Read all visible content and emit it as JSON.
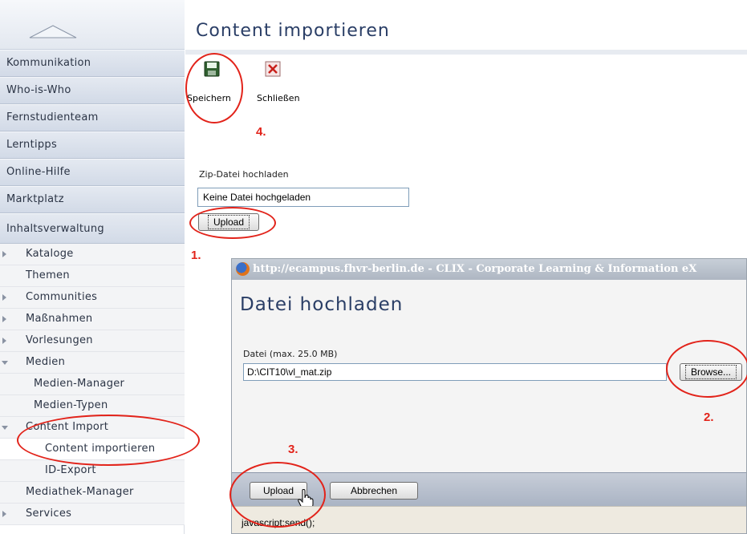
{
  "sidebar": {
    "main_items": [
      {
        "label": "Kommunikation"
      },
      {
        "label": "Who-is-Who"
      },
      {
        "label": "Fernstudienteam"
      },
      {
        "label": "Lerntipps"
      },
      {
        "label": "Online-Hilfe"
      },
      {
        "label": "Marktplatz"
      },
      {
        "label": "Inhaltsverwaltung"
      }
    ],
    "sub_items": [
      {
        "label": "Kataloge"
      },
      {
        "label": "Themen"
      },
      {
        "label": "Communities"
      },
      {
        "label": "Maßnahmen"
      },
      {
        "label": "Vorlesungen"
      },
      {
        "label": "Medien"
      },
      {
        "label": "Medien-Manager"
      },
      {
        "label": "Medien-Typen"
      },
      {
        "label": "Content Import"
      },
      {
        "label": "Content importieren"
      },
      {
        "label": "ID-Export"
      },
      {
        "label": "Mediathek-Manager"
      },
      {
        "label": "Services"
      }
    ]
  },
  "main": {
    "title": "Content importieren",
    "toolbar": {
      "save_label": "Speichern",
      "close_label": "Schließen"
    },
    "zip_label": "Zip-Datei hochladen",
    "zip_value": "Keine Datei hochgeladen",
    "upload_label": "Upload"
  },
  "dialog": {
    "window_title": "http://ecampus.fhvr-berlin.de - CLIX - Corporate Learning & Information eX",
    "heading": "Datei hochladen",
    "file_label": "Datei (max. 25.0 MB)",
    "file_value": "D:\\CIT10\\vl_mat.zip",
    "browse_label": "Browse...",
    "upload_label": "Upload",
    "cancel_label": "Abbrechen",
    "status_text": "javascript:send();"
  },
  "annotations": {
    "step1": "1.",
    "step2": "2.",
    "step3": "3.",
    "step4": "4."
  },
  "colors": {
    "annotation": "#e2231a",
    "title": "#2a3e66"
  }
}
